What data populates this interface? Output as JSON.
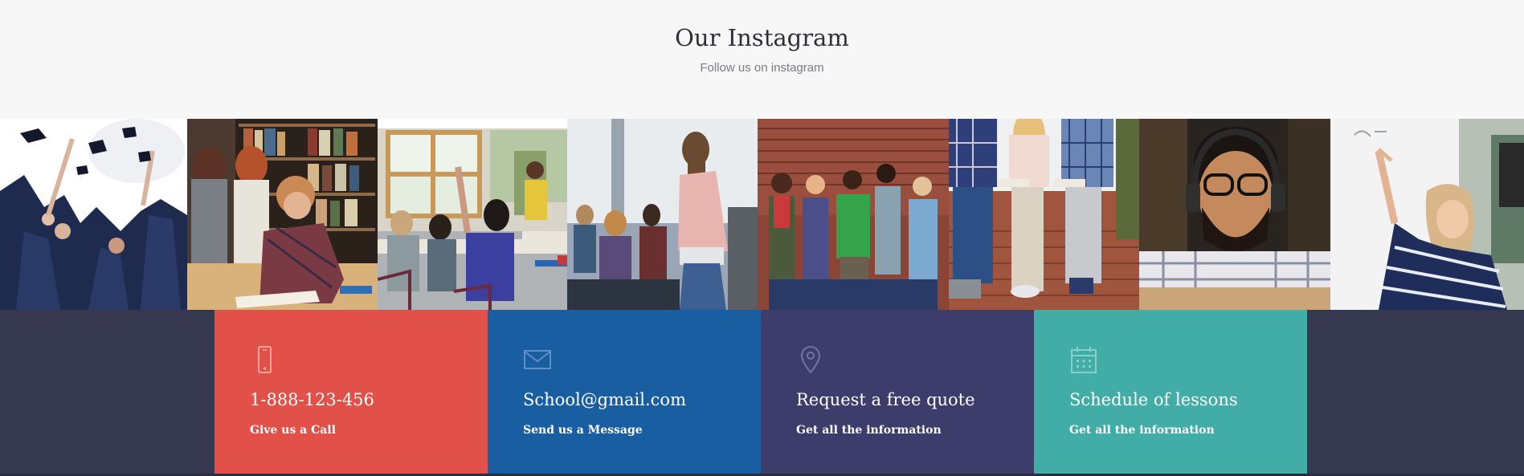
{
  "header": {
    "title": "Our Instagram",
    "subtitle": "Follow us on instagram"
  },
  "gallery": {
    "photos": [
      {
        "icon": "graduation-caps-photo"
      },
      {
        "icon": "library-student-photo"
      },
      {
        "icon": "classroom-photo"
      },
      {
        "icon": "seminar-photo"
      },
      {
        "icon": "students-brick-wall-photo"
      },
      {
        "icon": "students-sitting-photo"
      },
      {
        "icon": "student-headphones-photo"
      },
      {
        "icon": "whiteboard-photo"
      }
    ]
  },
  "contact": {
    "cards": [
      {
        "title": "1-888-123-456",
        "subtitle": "Give us a Call",
        "icon": "phone-icon",
        "color": "#e2504a",
        "icon_color": "#f6a59c"
      },
      {
        "title": "School@gmail.com",
        "subtitle": "Send us a Message",
        "icon": "envelope-icon",
        "color": "#1a5ea2",
        "icon_color": "#5e8fc6"
      },
      {
        "title": "Request a free quote",
        "subtitle": "Get all the information",
        "icon": "map-pin-icon",
        "color": "#3c3d6a",
        "icon_color": "#7274a8"
      },
      {
        "title": "Schedule of lessons",
        "subtitle": "Get all the information",
        "icon": "calendar-icon",
        "color": "#41ada6",
        "icon_color": "#86d0ca"
      }
    ]
  },
  "colors": {
    "header_bg": "#f7f7f7",
    "footer_bg": "#35384f"
  }
}
